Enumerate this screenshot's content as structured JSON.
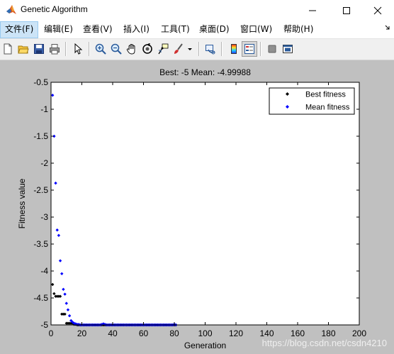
{
  "window": {
    "title": "Genetic Algorithm",
    "controls": [
      "minimize-icon",
      "maximize-icon",
      "close-icon"
    ]
  },
  "menu": {
    "items": [
      {
        "label": "文件(F)",
        "name": "menu-file",
        "active": true
      },
      {
        "label": "编辑(E)",
        "name": "menu-edit"
      },
      {
        "label": "查看(V)",
        "name": "menu-view"
      },
      {
        "label": "插入(I)",
        "name": "menu-insert"
      },
      {
        "label": "工具(T)",
        "name": "menu-tools"
      },
      {
        "label": "桌面(D)",
        "name": "menu-desktop"
      },
      {
        "label": "窗口(W)",
        "name": "menu-window"
      },
      {
        "label": "帮助(H)",
        "name": "menu-help"
      }
    ],
    "dock_icon": "dock-arrow-icon"
  },
  "toolbar": {
    "buttons": [
      "new-figure-icon",
      "open-file-icon",
      "save-icon",
      "print-icon",
      "select-arrow-icon",
      "zoom-in-icon",
      "zoom-out-icon",
      "pan-hand-icon",
      "rotate-3d-icon",
      "data-cursor-icon",
      "brush-icon",
      "brush-dropdown-icon",
      "link-plot-icon",
      "colorbar-icon",
      "legend-icon",
      "hide-plot-tools-icon",
      "show-plot-tools-icon"
    ]
  },
  "watermark": "https://blog.csdn.net/csdn4210",
  "chart_data": {
    "type": "scatter",
    "title": "Best: -5 Mean: -4.99988",
    "xlabel": "Generation",
    "ylabel": "Fitness value",
    "xlim": [
      0,
      200
    ],
    "ylim": [
      -5,
      -0.5
    ],
    "xticks": [
      0,
      20,
      40,
      60,
      80,
      100,
      120,
      140,
      160,
      180,
      200
    ],
    "yticks": [
      -0.5,
      -1,
      -1.5,
      -2,
      -2.5,
      -3,
      -3.5,
      -4,
      -4.5,
      -5
    ],
    "legend": {
      "placement": "top-right",
      "entries": [
        "Best fitness",
        "Mean fitness"
      ]
    },
    "colors": {
      "Best fitness": "#000000",
      "Mean fitness": "#0000ff",
      "figure_bg": "#c0c0c0",
      "axes_bg": "#ffffff"
    },
    "series": [
      {
        "name": "Best fitness",
        "x": [
          1,
          2,
          3,
          4,
          5,
          6,
          7,
          8,
          9,
          10,
          11,
          12,
          13,
          14,
          15,
          16,
          17,
          18,
          19,
          20,
          21,
          22,
          23,
          24,
          25,
          26,
          27,
          28,
          29,
          30,
          31,
          32,
          33,
          34,
          35,
          36,
          37,
          38,
          39,
          40,
          41,
          42,
          43,
          44,
          45,
          46,
          47,
          48,
          49,
          50,
          51,
          52,
          53,
          54,
          55,
          56,
          57,
          58,
          59,
          60,
          61,
          62,
          63,
          64,
          65,
          66,
          67,
          68,
          69,
          70,
          71,
          72,
          73,
          74,
          75,
          76,
          77,
          78,
          79,
          80,
          81
        ],
        "y": [
          -4.25,
          -4.42,
          -4.47,
          -4.47,
          -4.47,
          -4.47,
          -4.8,
          -4.8,
          -4.8,
          -4.97,
          -4.97,
          -4.97,
          -4.97,
          -4.97,
          -4.99,
          -4.99,
          -5,
          -5,
          -5,
          -5,
          -5,
          -5,
          -5,
          -5,
          -5,
          -5,
          -5,
          -5,
          -5,
          -5,
          -5,
          -5,
          -5,
          -5,
          -5,
          -5,
          -5,
          -5,
          -5,
          -5,
          -5,
          -5,
          -5,
          -5,
          -5,
          -5,
          -5,
          -5,
          -5,
          -5,
          -5,
          -5,
          -5,
          -5,
          -5,
          -5,
          -5,
          -5,
          -5,
          -5,
          -5,
          -5,
          -5,
          -5,
          -5,
          -5,
          -5,
          -5,
          -5,
          -5,
          -5,
          -5,
          -5,
          -5,
          -5,
          -5,
          -5,
          -5,
          -5,
          -5,
          -5
        ]
      },
      {
        "name": "Mean fitness",
        "x": [
          1,
          2,
          3,
          4,
          5,
          6,
          7,
          8,
          9,
          10,
          11,
          12,
          13,
          14,
          15,
          16,
          17,
          18,
          19,
          20,
          21,
          22,
          23,
          24,
          25,
          26,
          27,
          28,
          29,
          30,
          31,
          32,
          33,
          34,
          35,
          36,
          37,
          38,
          39,
          40,
          41,
          42,
          43,
          44,
          45,
          46,
          47,
          48,
          49,
          50,
          51,
          52,
          53,
          54,
          55,
          56,
          57,
          58,
          59,
          60,
          61,
          62,
          63,
          64,
          65,
          66,
          67,
          68,
          69,
          70,
          71,
          72,
          73,
          74,
          75,
          76,
          77,
          78,
          79,
          80,
          81
        ],
        "y": [
          -0.74,
          -1.5,
          -2.37,
          -3.24,
          -3.34,
          -3.81,
          -4.05,
          -4.34,
          -4.43,
          -4.6,
          -4.72,
          -4.83,
          -4.92,
          -4.95,
          -4.97,
          -4.98,
          -4.99,
          -4.99,
          -5,
          -5,
          -5,
          -5,
          -5,
          -5,
          -5,
          -5,
          -5,
          -5,
          -5,
          -5,
          -5,
          -5,
          -4.99,
          -4.98,
          -4.99,
          -5,
          -5,
          -5,
          -5,
          -5,
          -5,
          -5,
          -5,
          -5,
          -5,
          -5,
          -5,
          -5,
          -5,
          -5,
          -5,
          -5,
          -5,
          -5,
          -5,
          -5,
          -5,
          -5,
          -5,
          -5,
          -5,
          -5,
          -5,
          -5,
          -5,
          -5,
          -5,
          -5,
          -5,
          -5,
          -5,
          -5,
          -5,
          -5,
          -5,
          -5,
          -5,
          -5,
          -5,
          -4.99,
          -5
        ]
      }
    ]
  }
}
